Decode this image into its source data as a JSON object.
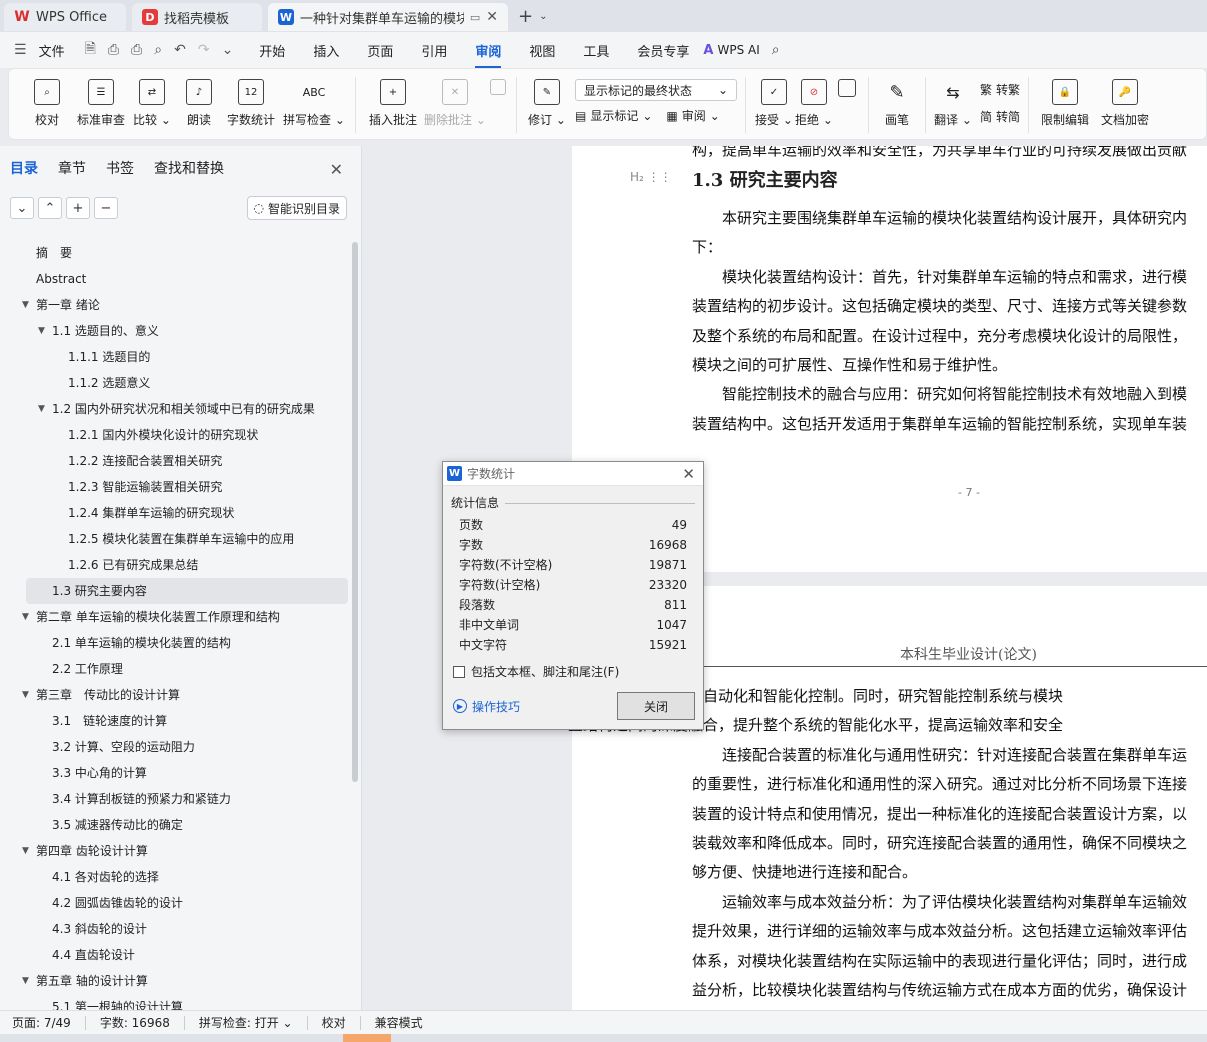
{
  "tabs": [
    {
      "label": "WPS Office",
      "icon": "wps-icon"
    },
    {
      "label": "找稻壳模板",
      "icon": "docer-icon"
    },
    {
      "label": "一种针对集群单车运输的模块化",
      "icon": "w-doc-icon"
    }
  ],
  "menu": {
    "file": "文件",
    "items": [
      "开始",
      "插入",
      "页面",
      "引用",
      "审阅",
      "视图",
      "工具",
      "会员专享"
    ],
    "active": "审阅",
    "ai": "WPS AI"
  },
  "ribbon": {
    "proofread": "校对",
    "standard_review": "标准审查",
    "compare": "比较",
    "read_aloud": "朗读",
    "word_count": "字数统计",
    "spell_check": "拼写检查",
    "insert_comment": "插入批注",
    "delete_comment": "删除批注",
    "revise": "修订",
    "display_status": "显示标记的最终状态",
    "show_markup": "显示标记",
    "review": "审阅",
    "accept": "接受",
    "reject": "拒绝",
    "pen": "画笔",
    "translate": "翻译",
    "to_traditional": "转繁",
    "to_simplified": "转简",
    "restrict_edit": "限制编辑",
    "encrypt": "文档加密"
  },
  "panel": {
    "tabs": [
      "目录",
      "章节",
      "书签",
      "查找和替换"
    ],
    "smart_toc": "智能识别目录",
    "toc": [
      {
        "label": "摘　要",
        "level": 0,
        "arrow": false
      },
      {
        "label": "Abstract",
        "level": 0,
        "arrow": false
      },
      {
        "label": "第一章  绪论",
        "level": 0,
        "arrow": true
      },
      {
        "label": "1.1 选题目的、意义",
        "level": 1,
        "arrow": true
      },
      {
        "label": "1.1.1  选题目的",
        "level": 2,
        "arrow": false
      },
      {
        "label": "1.1.2  选题意义",
        "level": 2,
        "arrow": false
      },
      {
        "label": "1.2 国内外研究状况和相关领域中已有的研究成果",
        "level": 1,
        "arrow": true
      },
      {
        "label": "1.2.1  国内外模块化设计的研究现状",
        "level": 2,
        "arrow": false
      },
      {
        "label": "1.2.2 连接配合装置相关研究",
        "level": 2,
        "arrow": false
      },
      {
        "label": "1.2.3 智能运输装置相关研究",
        "level": 2,
        "arrow": false
      },
      {
        "label": "1.2.4 集群单车运输的研究现状",
        "level": 2,
        "arrow": false
      },
      {
        "label": "1.2.5 模块化装置在集群单车运输中的应用",
        "level": 2,
        "arrow": false
      },
      {
        "label": "1.2.6  已有研究成果总结",
        "level": 2,
        "arrow": false
      },
      {
        "label": "1.3  研究主要内容",
        "level": 1,
        "arrow": false,
        "selected": true
      },
      {
        "label": "第二章  单车运输的模块化装置工作原理和结构",
        "level": 0,
        "arrow": true
      },
      {
        "label": "2.1  单车运输的模块化装置的结构",
        "level": 1,
        "arrow": false
      },
      {
        "label": "2.2  工作原理",
        "level": 1,
        "arrow": false
      },
      {
        "label": "第三章　传动比的设计计算",
        "level": 0,
        "arrow": true
      },
      {
        "label": "3.1　链轮速度的计算",
        "level": 1,
        "arrow": false
      },
      {
        "label": "3.2 计算、空段的运动阻力",
        "level": 1,
        "arrow": false
      },
      {
        "label": "3.3 中心角的计算",
        "level": 1,
        "arrow": false
      },
      {
        "label": "3.4 计算刮板链的预紧力和紧链力",
        "level": 1,
        "arrow": false
      },
      {
        "label": "3.5 减速器传动比的确定",
        "level": 1,
        "arrow": false
      },
      {
        "label": "第四章  齿轮设计计算",
        "level": 0,
        "arrow": true
      },
      {
        "label": "4.1 各对齿轮的选择",
        "level": 1,
        "arrow": false
      },
      {
        "label": "4.2  圆弧齿锥齿轮的设计",
        "level": 1,
        "arrow": false
      },
      {
        "label": "4.3  斜齿轮的设计",
        "level": 1,
        "arrow": false
      },
      {
        "label": "4.4  直齿轮设计",
        "level": 1,
        "arrow": false
      },
      {
        "label": "第五章  轴的设计计算",
        "level": 0,
        "arrow": true
      },
      {
        "label": "5.1 第一根轴的设计计算",
        "level": 1,
        "arrow": false
      }
    ]
  },
  "doc": {
    "page1_top_line": "构，提高单车运输的效率和安全性，为共享单车行业的可持续发展做出贡献",
    "heading": "1.3  研究主要内容",
    "h2_mark": "H₂",
    "page1_lines": [
      "　　本研究主要围绕集群单车运输的模块化装置结构设计展开，具体研究内",
      "下：",
      "　　模块化装置结构设计：首先，针对集群单车运输的特点和需求，进行模",
      "装置结构的初步设计。这包括确定模块的类型、尺寸、连接方式等关键参数",
      "及整个系统的布局和配置。在设计过程中，充分考虑模块化设计的局限性，",
      "模块之间的可扩展性、互操作性和易于维护性。",
      "　　智能控制技术的融合与应用：研究如何将智能控制技术有效地融入到模",
      "装置结构中。这包括开发适用于集群单车运输的智能控制系统，实现单车装"
    ],
    "page_number": "- 7 -",
    "page2_header": "本科生毕业设计(论文)",
    "page2_lines": [
      "卸载、运输过程中的自动化和智能化控制。同时，研究智能控制系统与模块",
      "置结构之间的深度融合，提升整个系统的智能化水平，提高运输效率和安全",
      "　　连接配合装置的标准化与通用性研究：针对连接配合装置在集群单车运",
      "的重要性，进行标准化和通用性的深入研究。通过对比分析不同场景下连接",
      "装置的设计特点和使用情况，提出一种标准化的连接配合装置设计方案，以",
      "装载效率和降低成本。同时，研究连接配合装置的通用性，确保不同模块之",
      "够方便、快捷地进行连接和配合。",
      "　　运输效率与成本效益分析：为了评估模块化装置结构对集群单车运输效",
      "提升效果，进行详细的运输效率与成本效益分析。这包括建立运输效率评估",
      "体系，对模块化装置结构在实际运输中的表现进行量化评估；同时，进行成",
      "益分析，比较模块化装置结构与传统运输方式在成本方面的优劣，确保设计"
    ]
  },
  "dialog": {
    "title": "字数统计",
    "section": "统计信息",
    "stats": [
      {
        "label": "页数",
        "value": "49"
      },
      {
        "label": "字数",
        "value": "16968"
      },
      {
        "label": "字符数(不计空格)",
        "value": "19871"
      },
      {
        "label": "字符数(计空格)",
        "value": "23320"
      },
      {
        "label": "段落数",
        "value": "811"
      },
      {
        "label": "非中文单词",
        "value": "1047"
      },
      {
        "label": "中文字符",
        "value": "15921"
      }
    ],
    "checkbox_label": "包括文本框、脚注和尾注(F)",
    "tips": "操作技巧",
    "close": "关闭"
  },
  "status": {
    "page": "页面: 7/49",
    "words": "字数: 16968",
    "spell": "拼写检查: 打开",
    "proof": "校对",
    "compat": "兼容模式"
  }
}
